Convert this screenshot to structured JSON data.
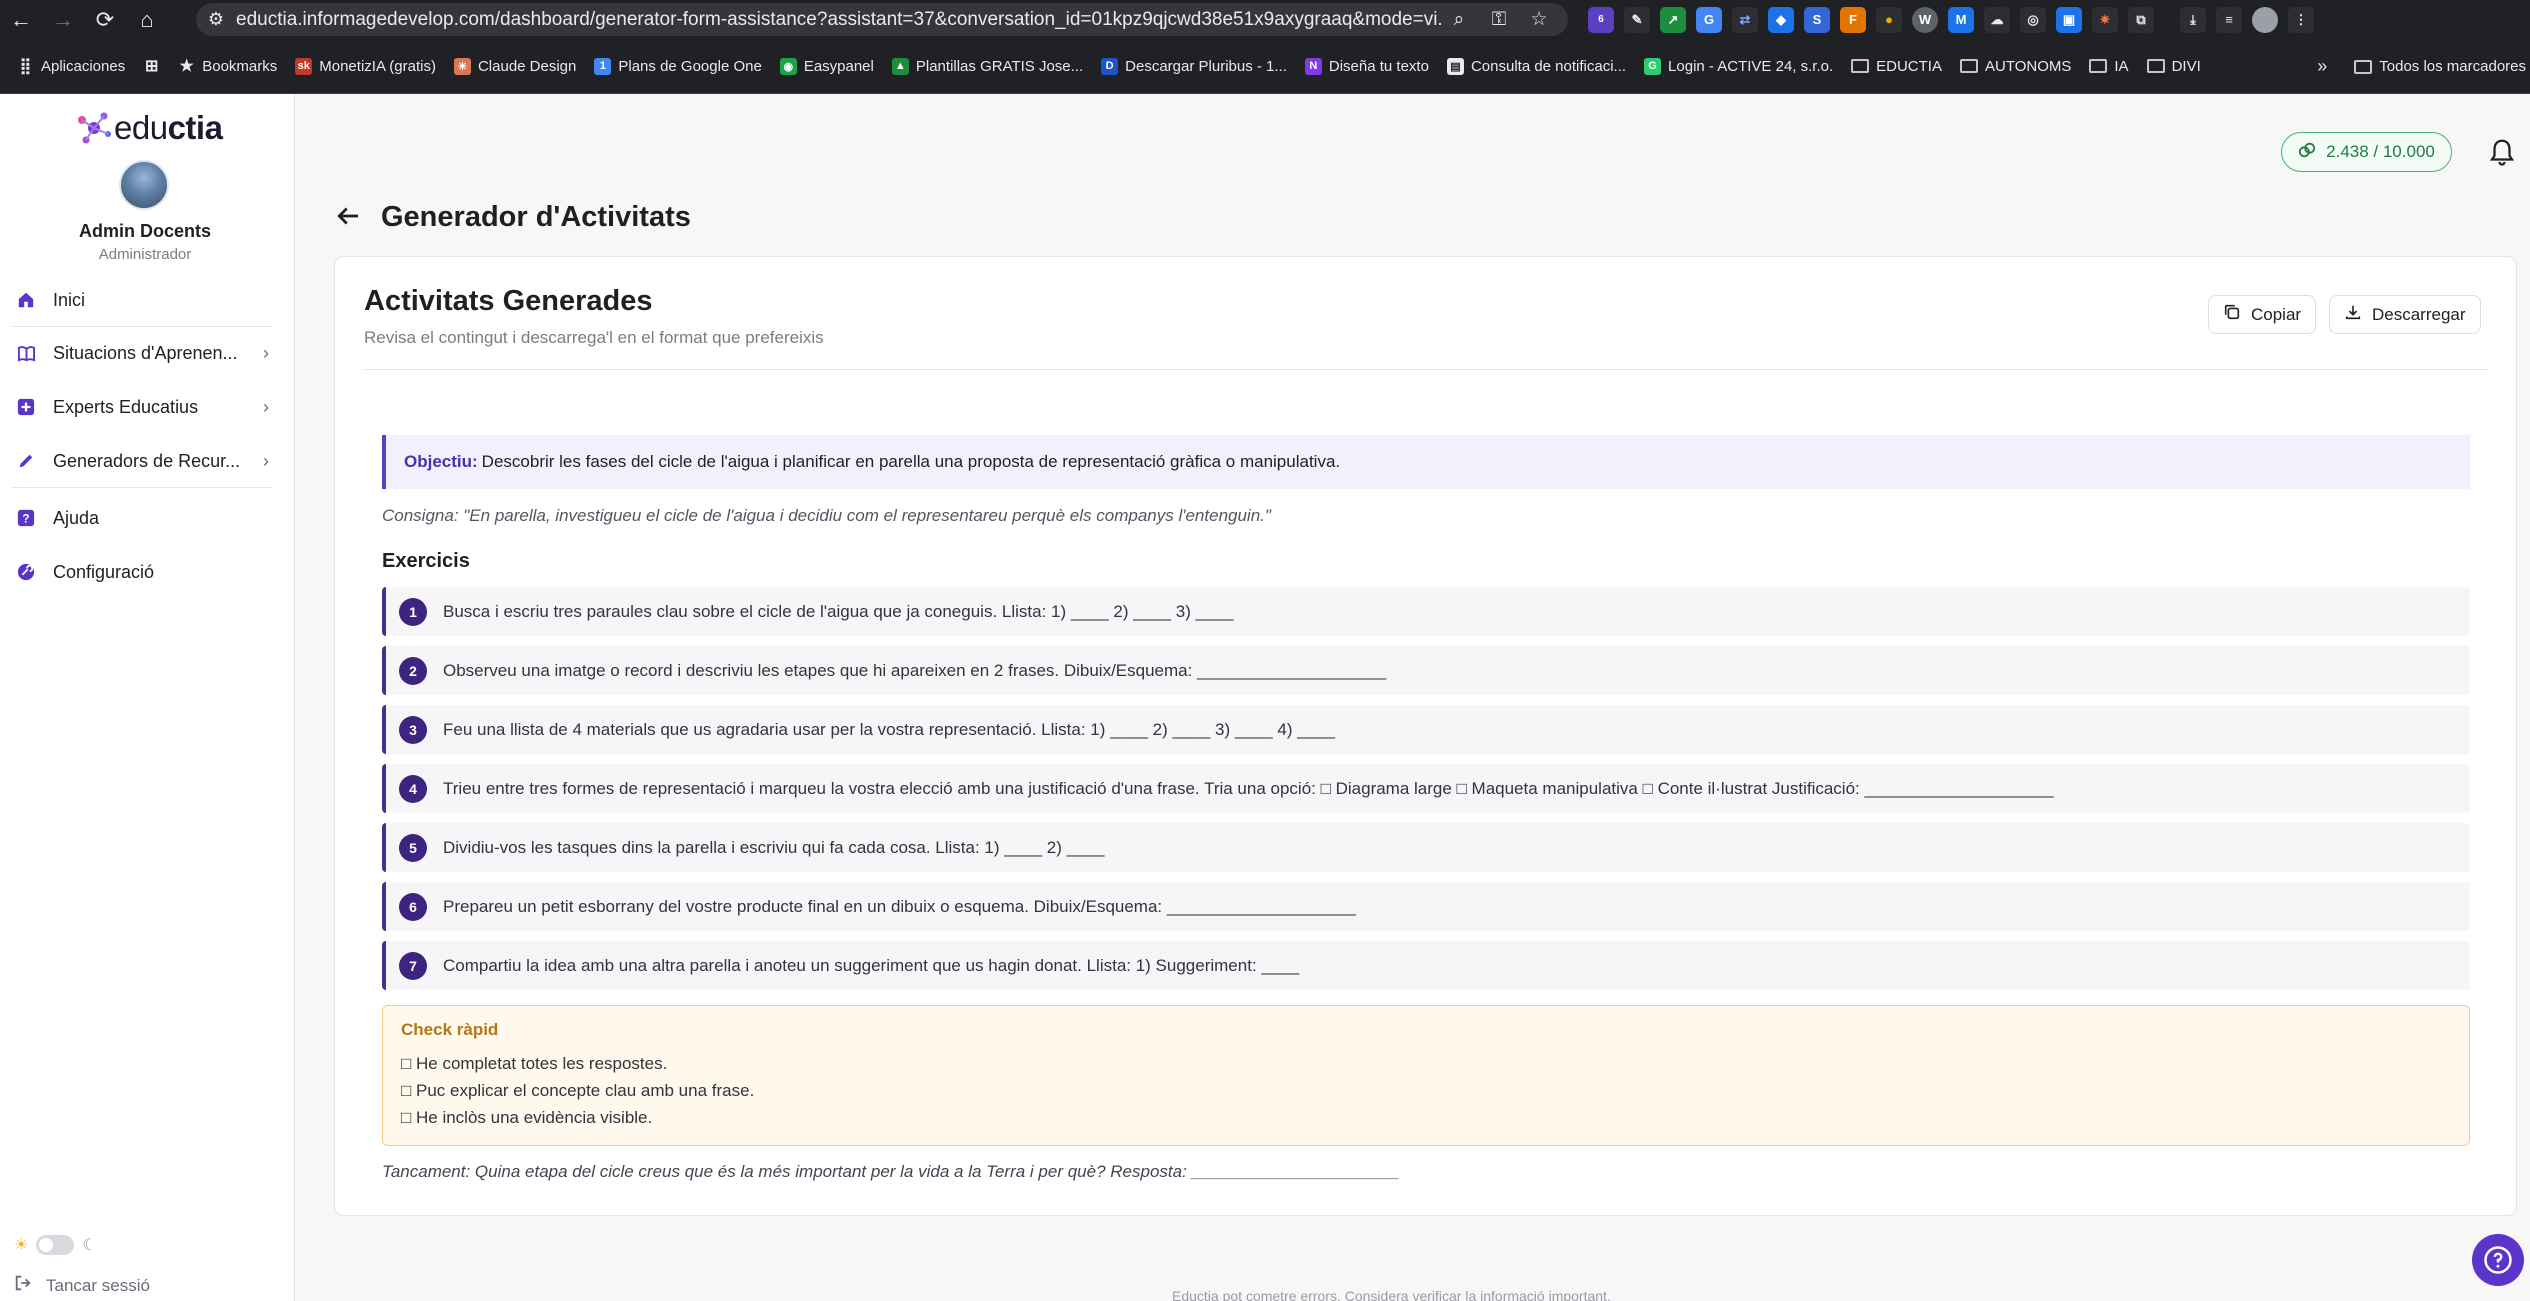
{
  "browser": {
    "url": "eductia.informagedevelop.com/dashboard/generator-form-assistance?assistant=37&conversation_id=01kpz9qjcwd38e51x9axygraaq&mode=vi...",
    "extension_badge": "6",
    "bookmarks": [
      {
        "label": "Aplicaciones",
        "icon": "apps-grid-icon"
      },
      {
        "label": "",
        "icon": "grid-icon"
      },
      {
        "label": "Bookmarks",
        "icon": "star-icon"
      },
      {
        "label": "MonetizIA (gratis)",
        "icon": "sk-icon"
      },
      {
        "label": "Claude Design",
        "icon": "claude-icon"
      },
      {
        "label": "Plans de Google One",
        "icon": "google-one-icon"
      },
      {
        "label": "Easypanel",
        "icon": "easypanel-icon"
      },
      {
        "label": "Plantillas GRATIS Jose...",
        "icon": "drive-icon"
      },
      {
        "label": "Descargar Pluribus - 1...",
        "icon": "pluribus-icon"
      },
      {
        "label": "Diseña tu texto",
        "icon": "notion-icon"
      },
      {
        "label": "Consulta de notificaci...",
        "icon": "page-icon"
      },
      {
        "label": "Login - ACTIVE 24, s.r.o.",
        "icon": "active24-icon"
      },
      {
        "label": "EDUCTIA",
        "icon": "folder-icon"
      },
      {
        "label": "AUTONOMS",
        "icon": "folder-icon"
      },
      {
        "label": "IA",
        "icon": "folder-icon"
      },
      {
        "label": "DIVI",
        "icon": "folder-icon"
      }
    ],
    "overflow": "»",
    "all_bookmarks": "Todos los marcadores"
  },
  "sidebar": {
    "logo_bold": "edu",
    "logo_rest": "ctia",
    "user_name": "Admin Docents",
    "user_role": "Administrador",
    "items": [
      {
        "label": "Inici",
        "icon": "home-icon",
        "chevron": ""
      },
      {
        "label": "Situacions d'Aprenen...",
        "icon": "book-icon",
        "chevron": "›"
      },
      {
        "label": "Experts Educatius",
        "icon": "plus-square-icon",
        "chevron": "›"
      },
      {
        "label": "Generadors de Recur...",
        "icon": "pencil-icon",
        "chevron": "›"
      },
      {
        "label": "Ajuda",
        "icon": "help-icon",
        "chevron": ""
      },
      {
        "label": "Configuració",
        "icon": "settings-icon",
        "chevron": ""
      }
    ],
    "logout": "Tancar sessió"
  },
  "topbar": {
    "credits": "2.438 / 10.000"
  },
  "page": {
    "title": "Generador d'Activitats"
  },
  "card": {
    "title": "Activitats Generades",
    "subtitle": "Revisa el contingut i descarrega'l en el format que prefereixis",
    "copy_label": "Copiar",
    "download_label": "Descarregar"
  },
  "content": {
    "objective_label": "Objectiu:",
    "objective_text": "Descobrir les fases del cicle de l'aigua i planificar en parella una proposta de representació gràfica o manipulativa.",
    "consigna": "Consigna: \"En parella, investigueu el cicle de l'aigua i decidiu com el representareu perquè els companys l'entenguin.\"",
    "exercises_title": "Exercicis",
    "exercises": [
      {
        "num": "1",
        "text": "Busca i escriu tres paraules clau sobre el cicle de l'aigua que ja coneguis. Llista: 1) ____ 2) ____ 3) ____"
      },
      {
        "num": "2",
        "text": "Observeu una imatge o record i descriviu les etapes que hi apareixen en 2 frases. Dibuix/Esquema: ____________________"
      },
      {
        "num": "3",
        "text": "Feu una llista de 4 materials que us agradaria usar per la vostra representació. Llista: 1) ____ 2) ____ 3) ____ 4) ____"
      },
      {
        "num": "4",
        "text": "Trieu entre tres formes de representació i marqueu la vostra elecció amb una justificació d'una frase. Tria una opció: □ Diagrama large □ Maqueta manipulativa □ Conte il·lustrat Justificació: ____________________"
      },
      {
        "num": "5",
        "text": "Dividiu-vos les tasques dins la parella i escriviu qui fa cada cosa. Llista: 1) ____ 2) ____"
      },
      {
        "num": "6",
        "text": "Prepareu un petit esborrany del vostre producte final en un dibuix o esquema. Dibuix/Esquema: ____________________"
      },
      {
        "num": "7",
        "text": "Compartiu la idea amb una altra parella i anoteu un suggeriment que us hagin donat. Llista: 1) Suggeriment: ____"
      }
    ],
    "check_title": "Check ràpid",
    "check_items": [
      "□ He completat totes les respostes.",
      "□ Puc explicar el concepte clau amb una frase.",
      "□ He inclòs una evidència visible."
    ],
    "closing": "Tancament: Quina etapa del cicle creus que és la més important per la vida a la Terra i per què? Resposta: ______________________"
  },
  "footer": {
    "note": "Eductia pot cometre errors. Considera verificar la informació important."
  },
  "colors": {
    "accent": "#5b34c9",
    "exercise_number": "#3d2480",
    "credits_green": "#43b36f",
    "check_orange": "#b4761a"
  }
}
